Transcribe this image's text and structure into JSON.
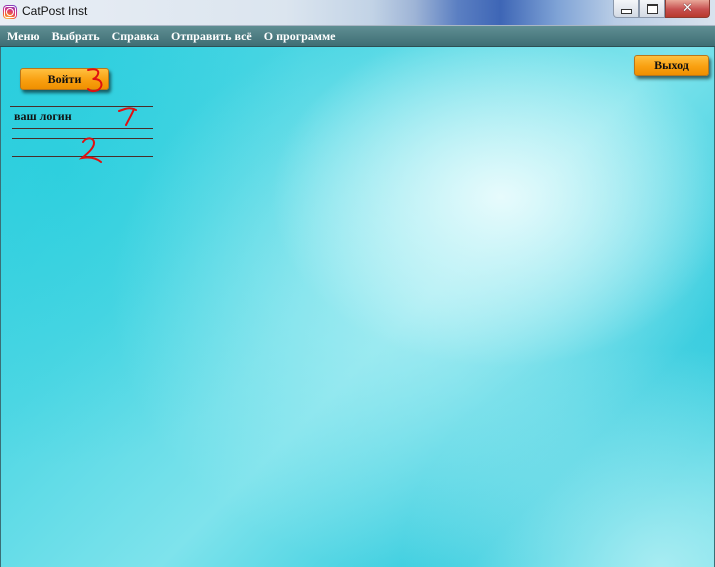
{
  "window": {
    "title": "CatPost Inst",
    "controls": {
      "close_glyph": "✕"
    }
  },
  "menubar": {
    "items": [
      {
        "label": "Меню"
      },
      {
        "label": "Выбрать"
      },
      {
        "label": "Справка"
      },
      {
        "label": "Отправить всё"
      },
      {
        "label": "О программе"
      }
    ]
  },
  "main": {
    "login_button": "Войти",
    "exit_button": "Выход",
    "login_field": "ваш логин",
    "password_field": ""
  },
  "annotations": {
    "marker_1": "1",
    "marker_2": "2",
    "marker_3": "3",
    "color": "#e01010"
  },
  "colors": {
    "button_orange": "#f9a011",
    "menubar": "#4f7e84",
    "background_cyan": "#33cfe0"
  }
}
